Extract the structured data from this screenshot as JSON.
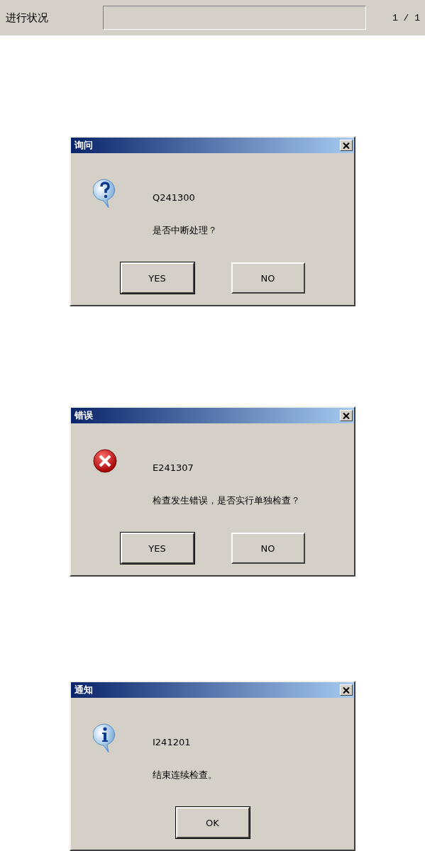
{
  "progress": {
    "label": "进行状况",
    "level": 0,
    "counter": "1 / 1"
  },
  "dialogs": [
    {
      "kind": "question",
      "title": "询问",
      "code": "Q241300",
      "message": "是否中断处理？",
      "buttons": [
        {
          "label": "YES",
          "default": true
        },
        {
          "label": "NO",
          "default": false
        }
      ]
    },
    {
      "kind": "error",
      "title": "错误",
      "code": "E241307",
      "message": "检查发生错误，是否实行单独检查？",
      "buttons": [
        {
          "label": "YES",
          "default": true
        },
        {
          "label": "NO",
          "default": false
        }
      ]
    },
    {
      "kind": "info",
      "title": "通知",
      "code": "I241201",
      "message": "结束连续检查。",
      "buttons": [
        {
          "label": "OK",
          "default": true
        }
      ]
    }
  ]
}
